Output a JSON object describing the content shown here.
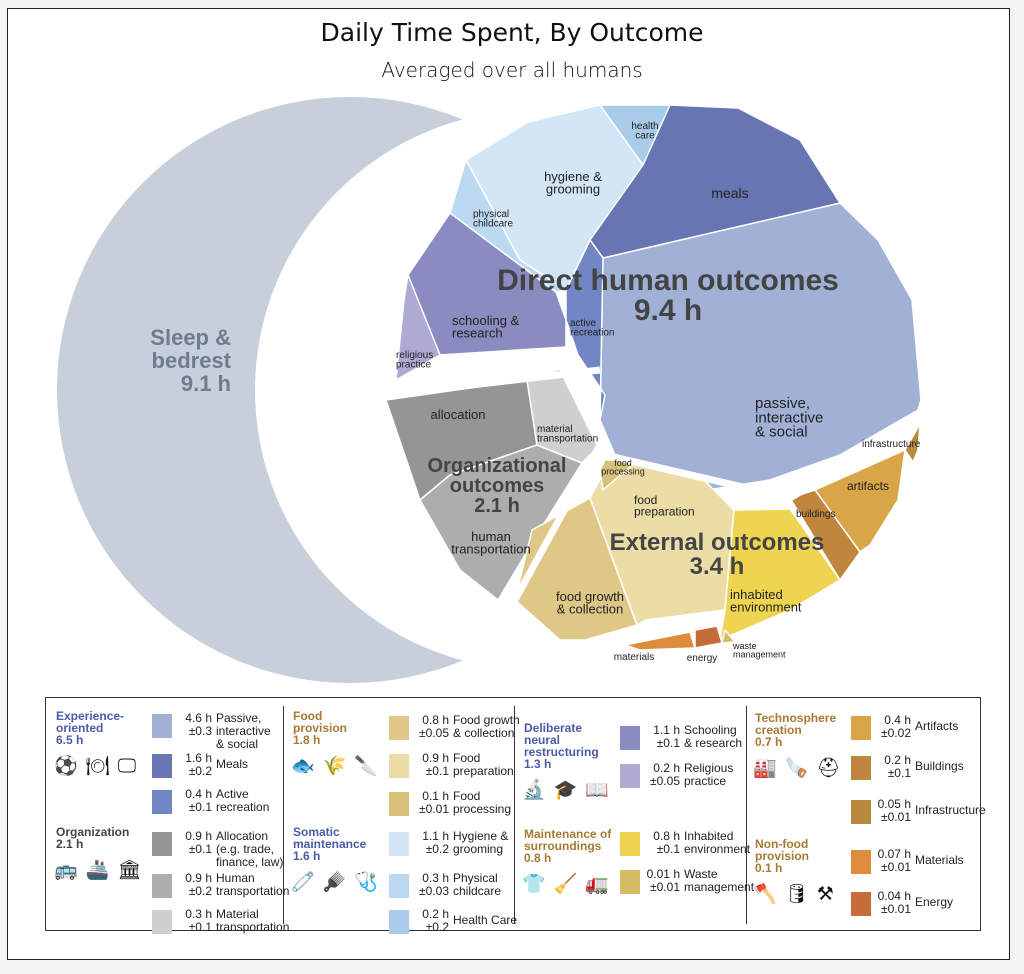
{
  "header": {
    "title": "Daily Time Spent, By Outcome",
    "subtitle": "Averaged over all humans"
  },
  "chart_data": {
    "type": "voronoi-treemap",
    "title": "Daily Time Spent, By Outcome",
    "subtitle": "Averaged over all humans",
    "units": "hours per day",
    "sleep": {
      "label": "Sleep & bedrest",
      "value": 9.1,
      "value_label": "9.1 h",
      "color": "#c6cfda"
    },
    "groups": [
      {
        "name": "Direct human outcomes",
        "value": 9.4,
        "value_label": "9.4 h",
        "cells": [
          {
            "label": "passive, interactive & social",
            "value": 4.6,
            "color": "#a1b1d6"
          },
          {
            "label": "meals",
            "value": 1.6,
            "color": "#6875b3"
          },
          {
            "label": "active recreation",
            "value": 0.4,
            "color": "#7186c2"
          },
          {
            "label": "hygiene & grooming",
            "value": 1.1,
            "color": "#d3e6f6"
          },
          {
            "label": "physical childcare",
            "value": 0.3,
            "color": "#bcd9f0"
          },
          {
            "label": "health care",
            "value": 0.2,
            "color": "#a9cceb"
          },
          {
            "label": "schooling & research",
            "value": 1.1,
            "color": "#8a8bc1"
          },
          {
            "label": "religious practice",
            "value": 0.2,
            "color": "#adaad4"
          }
        ]
      },
      {
        "name": "Organizational outcomes",
        "value": 2.1,
        "value_label": "2.1 h",
        "cells": [
          {
            "label": "allocation",
            "value": 0.9,
            "color": "#959595"
          },
          {
            "label": "human transportation",
            "value": 0.9,
            "color": "#adadad"
          },
          {
            "label": "material transportation",
            "value": 0.3,
            "color": "#cfcfcf"
          }
        ]
      },
      {
        "name": "External outcomes",
        "value": 3.4,
        "value_label": "3.4 h",
        "cells": [
          {
            "label": "food growth & collection",
            "value": 0.8,
            "color": "#dfc887"
          },
          {
            "label": "food preparation",
            "value": 0.9,
            "color": "#ecdda6"
          },
          {
            "label": "food processing",
            "value": 0.1,
            "color": "#d8c07a"
          },
          {
            "label": "inhabited environment",
            "value": 0.8,
            "color": "#efd452"
          },
          {
            "label": "waste management",
            "value": 0.01,
            "color": "#d5bd64"
          },
          {
            "label": "artifacts",
            "value": 0.4,
            "color": "#d8a549"
          },
          {
            "label": "buildings",
            "value": 0.2,
            "color": "#c0863d"
          },
          {
            "label": "infrastructure",
            "value": 0.05,
            "color": "#b98a3e"
          },
          {
            "label": "materials",
            "value": 0.07,
            "color": "#de8b3b"
          },
          {
            "label": "energy",
            "value": 0.04,
            "color": "#c46d3a"
          }
        ]
      }
    ]
  },
  "legend": {
    "columns": [
      {
        "groups": [
          {
            "title": [
              "Experience-",
              "oriented",
              "6.5 h"
            ],
            "color": "#4a5aa8",
            "icons": [
              "soccer-ball-icon",
              "plate-cutlery-icon",
              "monitor-icon"
            ],
            "icon_glyphs": "⚽ 🍽 🖵",
            "items": [
              {
                "value": "4.6 h",
                "error": "±0.3",
                "label": [
                  "Passive,",
                  "interactive",
                  "& social"
                ],
                "color": "#a1b1d6"
              },
              {
                "value": "1.6 h",
                "error": "±0.2",
                "label": [
                  "Meals"
                ],
                "color": "#6875b3"
              },
              {
                "value": "0.4 h",
                "error": "±0.1",
                "label": [
                  "Active",
                  "recreation"
                ],
                "color": "#7186c2"
              }
            ]
          },
          {
            "title": [
              "Organization",
              "2.1 h"
            ],
            "color": "#444444",
            "icons": [
              "bus-icon",
              "ship-icon",
              "bank-icon"
            ],
            "icon_glyphs": "🚌 🚢 🏛",
            "items": [
              {
                "value": "0.9 h",
                "error": "±0.1",
                "label": [
                  "Allocation",
                  "(e.g. trade,",
                  "finance, law)"
                ],
                "color": "#959595"
              },
              {
                "value": "0.9 h",
                "error": "±0.2",
                "label": [
                  "Human",
                  "transportation"
                ],
                "color": "#adadad"
              },
              {
                "value": "0.3 h",
                "error": "±0.1",
                "label": [
                  "Material",
                  "transportation"
                ],
                "color": "#cfcfcf"
              }
            ]
          }
        ]
      },
      {
        "groups": [
          {
            "title": [
              "Food",
              "provision",
              "1.8 h"
            ],
            "color": "#a77a33",
            "icons": [
              "fish-icon",
              "wheat-icon",
              "knife-icon"
            ],
            "icon_glyphs": "🐟 🌾 🔪",
            "items": [
              {
                "value": "0.8 h",
                "error": "±0.05",
                "label": [
                  "Food growth",
                  "& collection"
                ],
                "color": "#dfc887"
              },
              {
                "value": "0.9 h",
                "error": "±0.1",
                "label": [
                  "Food",
                  "preparation"
                ],
                "color": "#ecdda6"
              },
              {
                "value": "0.1 h",
                "error": "±0.01",
                "label": [
                  "Food",
                  "processing"
                ],
                "color": "#d8c07a"
              }
            ]
          },
          {
            "title": [
              "Somatic",
              "maintenance",
              "1.6 h"
            ],
            "color": "#4a5aa8",
            "icons": [
              "diaper-icon",
              "comb-icon",
              "stethoscope-icon"
            ],
            "icon_glyphs": "🧷 🪮 🩺",
            "items": [
              {
                "value": "1.1 h",
                "error": "±0.2",
                "label": [
                  "Hygiene &",
                  "grooming"
                ],
                "color": "#d3e6f6"
              },
              {
                "value": "0.3 h",
                "error": "±0.03",
                "label": [
                  "Physical",
                  "childcare"
                ],
                "color": "#bcd9f0"
              },
              {
                "value": "0.2 h",
                "error": "±0.2",
                "label": [
                  "Health Care"
                ],
                "color": "#a9cceb"
              }
            ]
          }
        ]
      },
      {
        "groups": [
          {
            "title": [
              "Deliberate",
              "neural",
              "restructuring",
              "1.3 h"
            ],
            "color": "#4a5aa8",
            "icons": [
              "microscope-icon",
              "graduation-cap-icon",
              "book-icon"
            ],
            "icon_glyphs": "🔬 🎓 📖",
            "items": [
              {
                "value": "1.1 h",
                "error": "±0.1",
                "label": [
                  "Schooling",
                  "& research"
                ],
                "color": "#8a8bc1"
              },
              {
                "value": "0.2 h",
                "error": "±0.05",
                "label": [
                  "Religious",
                  "practice"
                ],
                "color": "#adaad4"
              }
            ]
          },
          {
            "title": [
              "Maintenance of",
              "surroundings",
              "0.8 h"
            ],
            "color": "#a77a33",
            "icons": [
              "hanger-icon",
              "broom-icon",
              "garbage-truck-icon"
            ],
            "icon_glyphs": "👕 🧹 🚛",
            "items": [
              {
                "value": "0.8 h",
                "error": "±0.1",
                "label": [
                  "Inhabited",
                  "environment"
                ],
                "color": "#efd452"
              },
              {
                "value": "0.01 h",
                "error": "±0.01",
                "label": [
                  "Waste",
                  "management"
                ],
                "color": "#d5bd64"
              }
            ]
          }
        ]
      },
      {
        "groups": [
          {
            "title": [
              "Technosphere",
              "creation",
              "0.7 h"
            ],
            "color": "#a77a33",
            "icons": [
              "factory-icon",
              "saw-icon",
              "hard-hat-icon"
            ],
            "icon_glyphs": "🏭 🪚 ⛑",
            "items": [
              {
                "value": "0.4 h",
                "error": "±0.02",
                "label": [
                  "Artifacts"
                ],
                "color": "#d8a549"
              },
              {
                "value": "0.2 h",
                "error": "±0.1",
                "label": [
                  "Buildings"
                ],
                "color": "#c0863d"
              },
              {
                "value": "0.05 h",
                "error": "±0.01",
                "label": [
                  "Infrastructure"
                ],
                "color": "#b98a3e"
              }
            ]
          },
          {
            "title": [
              "Non-food",
              "provision",
              "0.1 h"
            ],
            "color": "#a77a33",
            "icons": [
              "axe-icon",
              "barrel-icon",
              "pickaxe-shovel-icon"
            ],
            "icon_glyphs": "🪓 🛢 ⚒",
            "items": [
              {
                "value": "0.07 h",
                "error": "±0.01",
                "label": [
                  "Materials"
                ],
                "color": "#de8b3b"
              },
              {
                "value": "0.04 h",
                "error": "±0.01",
                "label": [
                  "Energy"
                ],
                "color": "#c46d3a"
              }
            ]
          }
        ]
      }
    ]
  }
}
